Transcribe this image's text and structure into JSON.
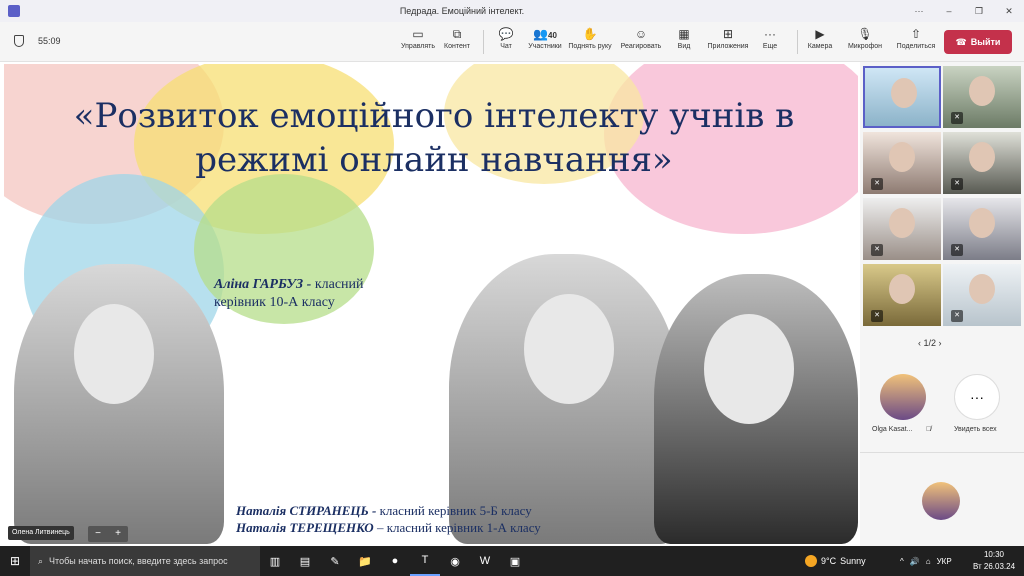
{
  "window": {
    "title": "Педрада. Емоційний інтелект."
  },
  "meeting": {
    "timer": "55:09"
  },
  "toolbar": {
    "manage": "Управлять",
    "content": "Контент",
    "chat": "Чат",
    "participants_count": "40",
    "participants": "Участники",
    "raise_hand": "Поднять руку",
    "react": "Реагировать",
    "view": "Вид",
    "apps": "Приложения",
    "more": "Еще",
    "camera": "Камера",
    "mic": "Микрофон",
    "share": "Поделиться",
    "leave": "Выйти"
  },
  "slide": {
    "title_line1": "«Розвиток емоційного інтелекту учнів  в",
    "title_line2": "режимі онлайн навчання»",
    "caption1_name": "Аліна ГАРБУЗ - ",
    "caption1_role_a": "класний",
    "caption1_role_b": "керівник 10-А класу",
    "caption2_name": "Наталія СТИРАНЕЦЬ - ",
    "caption2_role": " класний керівник 5-Б класу",
    "caption3_name": "Наталія ТЕРЕЩЕНКО ",
    "caption3_role": " – класний керівник 1-А класу",
    "speaker": "Олена Литвинець",
    "zoom_minus": "−",
    "zoom_plus": "+"
  },
  "gallery": {
    "pager": "1/2",
    "pinned_name": "Olga Kasat...",
    "view_all": "Увидеть всех"
  },
  "taskbar": {
    "search_placeholder": "Чтобы начать поиск, введите здесь запрос",
    "temperature": "9°C",
    "weather": "Sunny",
    "language": "УКР",
    "time": "10:30",
    "date": "Вт 26.03.24"
  }
}
